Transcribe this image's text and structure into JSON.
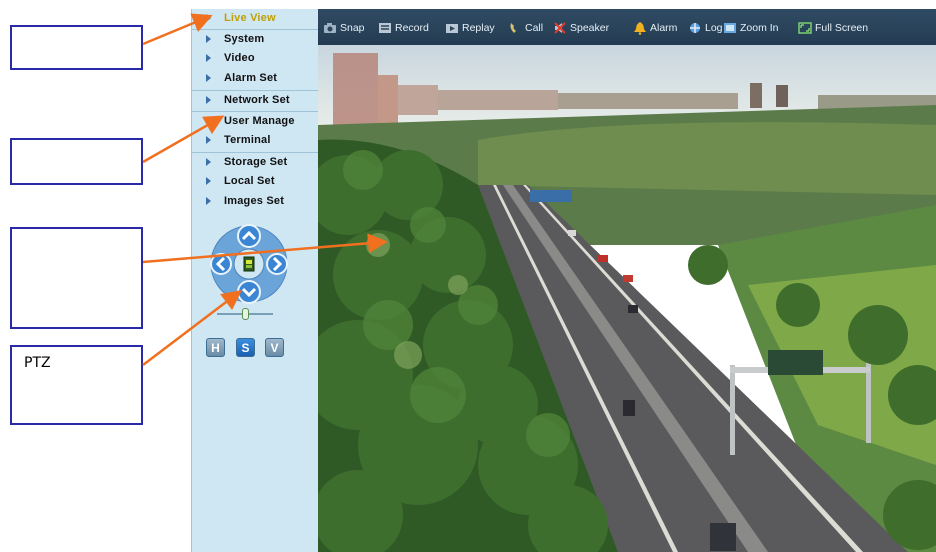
{
  "callouts": [
    {
      "id": "c1",
      "text": ""
    },
    {
      "id": "c2",
      "text": ""
    },
    {
      "id": "c3",
      "text": ""
    },
    {
      "id": "c4",
      "text": "PTZ"
    }
  ],
  "sidebar": {
    "items": [
      {
        "label": "Live View",
        "active": true
      },
      {
        "label": "System"
      },
      {
        "label": "Video"
      },
      {
        "label": "Alarm Set"
      },
      {
        "label": "Network Set"
      },
      {
        "label": "User Manage"
      },
      {
        "label": "Terminal"
      },
      {
        "label": "Storage Set"
      },
      {
        "label": "Local Set"
      },
      {
        "label": "Images Set"
      }
    ]
  },
  "ptz": {
    "buttons": {
      "h": "H",
      "s": "S",
      "v": "V"
    }
  },
  "toolbar": {
    "items": [
      {
        "label": "Snap",
        "icon": "camera-icon"
      },
      {
        "label": "Record",
        "icon": "record-icon"
      },
      {
        "label": "Replay",
        "icon": "replay-icon"
      },
      {
        "label": "Call",
        "icon": "call-icon"
      },
      {
        "label": "Speaker",
        "icon": "speaker-icon"
      },
      {
        "label": "Alarm",
        "icon": "alarm-bell-icon"
      },
      {
        "label": "Log",
        "icon": "log-icon"
      },
      {
        "label": "Zoom In",
        "icon": "zoom-in-icon"
      },
      {
        "label": "Full Screen",
        "icon": "full-screen-icon"
      }
    ]
  },
  "colors": {
    "toolbar_bg": "#2a4459",
    "sidebar_bg": "#cfe6f3",
    "callout_border": "#2a2aa8",
    "arrow": "#f07020",
    "active_menu": "#c0a000"
  }
}
